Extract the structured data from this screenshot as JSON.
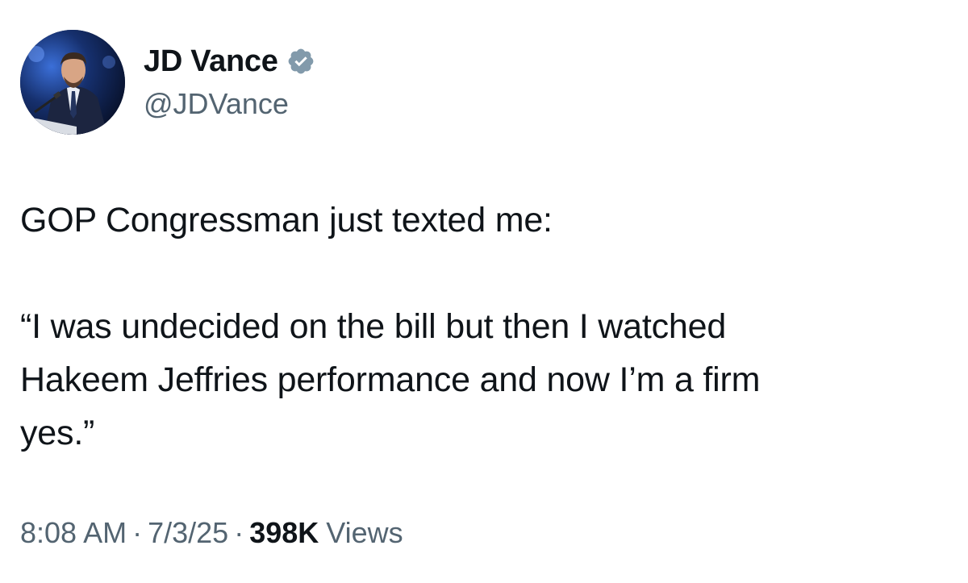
{
  "author": {
    "display_name": "JD Vance",
    "handle": "@JDVance",
    "verified": true,
    "verified_badge_color": "#829aab"
  },
  "tweet": {
    "line1": "GOP Congressman just texted me:",
    "line2": "“I was undecided on the bill but then I watched",
    "line3": "Hakeem Jeffries performance and now I’m a firm",
    "line4": "yes.”"
  },
  "meta": {
    "time": "8:08 AM",
    "separator": "·",
    "date": "7/3/25",
    "views_count": "398K",
    "views_label": "Views"
  },
  "colors": {
    "text_primary": "#0f1419",
    "text_secondary": "#536471"
  },
  "icons": {
    "verified": "verified-badge-icon"
  }
}
